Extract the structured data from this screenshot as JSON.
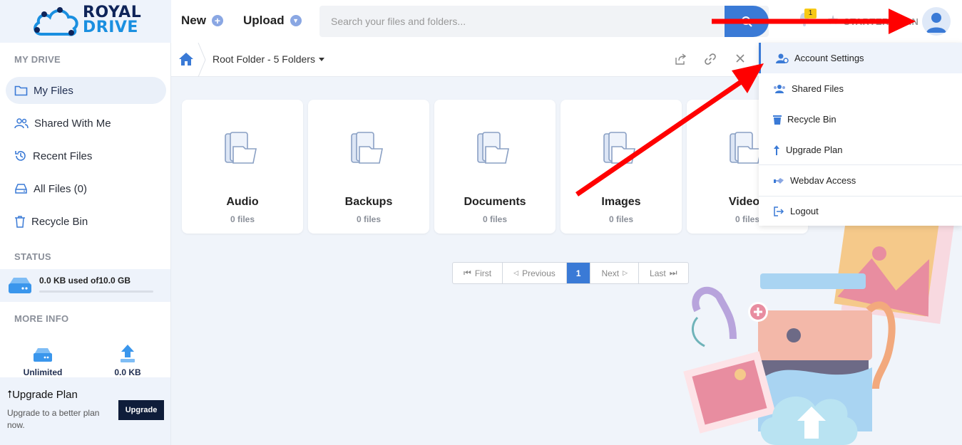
{
  "brand": {
    "line1": "ROYAL",
    "line2": "DRIVE"
  },
  "header": {
    "new_label": "New",
    "upload_label": "Upload",
    "search_placeholder": "Search your files and folders...",
    "notification_count": "1",
    "plan_label": "STARTER PLAN"
  },
  "sidebar": {
    "my_drive_title": "MY DRIVE",
    "items": [
      {
        "label": "My Files",
        "icon": "folder-icon"
      },
      {
        "label": "Shared With Me",
        "icon": "users-icon"
      },
      {
        "label": "Recent Files",
        "icon": "history-icon"
      },
      {
        "label": "All Files (0)",
        "icon": "hard-drive-icon"
      },
      {
        "label": "Recycle Bin",
        "icon": "trash-icon"
      }
    ],
    "status_title": "STATUS",
    "storage_text": "0.0 KB used of10.0 GB",
    "storage_fraction": 0,
    "more_info_title": "MORE INFO",
    "info_quota": "Unlimited",
    "info_upload": "0.0 KB",
    "upgrade_title": "Upgrade Plan",
    "upgrade_desc": "Upgrade to a better plan now.",
    "upgrade_button": "Upgrade"
  },
  "breadcrumb": {
    "text": "Root Folder - 5 Folders"
  },
  "folders": [
    {
      "name": "Audio",
      "count": "0 files"
    },
    {
      "name": "Backups",
      "count": "0 files"
    },
    {
      "name": "Documents",
      "count": "0 files"
    },
    {
      "name": "Images",
      "count": "0 files"
    },
    {
      "name": "Videos",
      "count": "0 files"
    }
  ],
  "pagination": {
    "first": "First",
    "previous": "Previous",
    "current": "1",
    "next": "Next",
    "last": "Last"
  },
  "account_menu": {
    "items": [
      {
        "label": "Account Settings",
        "icon": "user-cog-icon"
      },
      {
        "label": "Shared Files",
        "icon": "users-icon"
      },
      {
        "label": "Recycle Bin",
        "icon": "trash-icon"
      },
      {
        "label": "Upgrade Plan",
        "icon": "upgrade-arrow-icon"
      },
      {
        "label": "Webdav Access",
        "icon": "share-hand-icon"
      },
      {
        "label": "Logout",
        "icon": "logout-icon"
      }
    ]
  },
  "colors": {
    "accent": "#3a7ad6",
    "brand_dark": "#0f2459",
    "brand_light": "#1a8fe0",
    "annotation": "#ff0000"
  }
}
